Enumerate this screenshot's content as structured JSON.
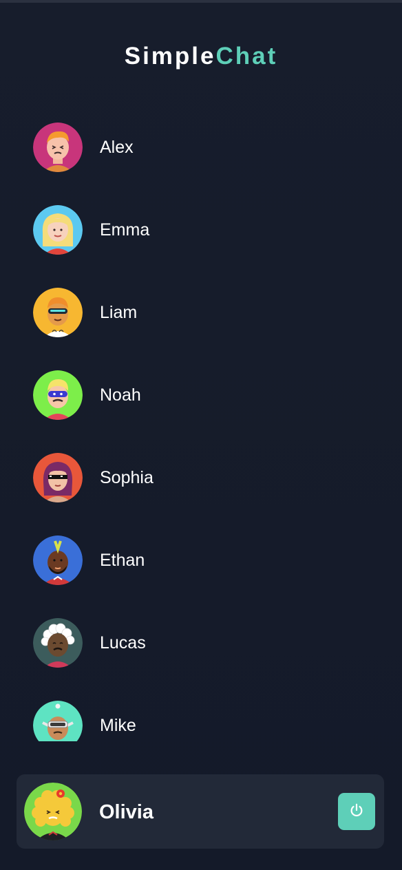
{
  "app": {
    "logo_part1": "Simple",
    "logo_part2": "Chat"
  },
  "colors": {
    "accent": "#5ecfb8",
    "background": "#161c2b",
    "panel": "#222938"
  },
  "contacts": [
    {
      "name": "Alex",
      "avatar_bg": "#c8357b"
    },
    {
      "name": "Emma",
      "avatar_bg": "#5cc9f0"
    },
    {
      "name": "Liam",
      "avatar_bg": "#f7b731"
    },
    {
      "name": "Noah",
      "avatar_bg": "#7dee4a"
    },
    {
      "name": "Sophia",
      "avatar_bg": "#e8573a"
    },
    {
      "name": "Ethan",
      "avatar_bg": "#3a6fd8"
    },
    {
      "name": "Lucas",
      "avatar_bg": "#3c5c5c"
    },
    {
      "name": "Mike",
      "avatar_bg": "#5ee3c2"
    }
  ],
  "current_user": {
    "name": "Olivia",
    "avatar_bg": "#7ad84a"
  },
  "icons": {
    "logout": "power-icon"
  }
}
